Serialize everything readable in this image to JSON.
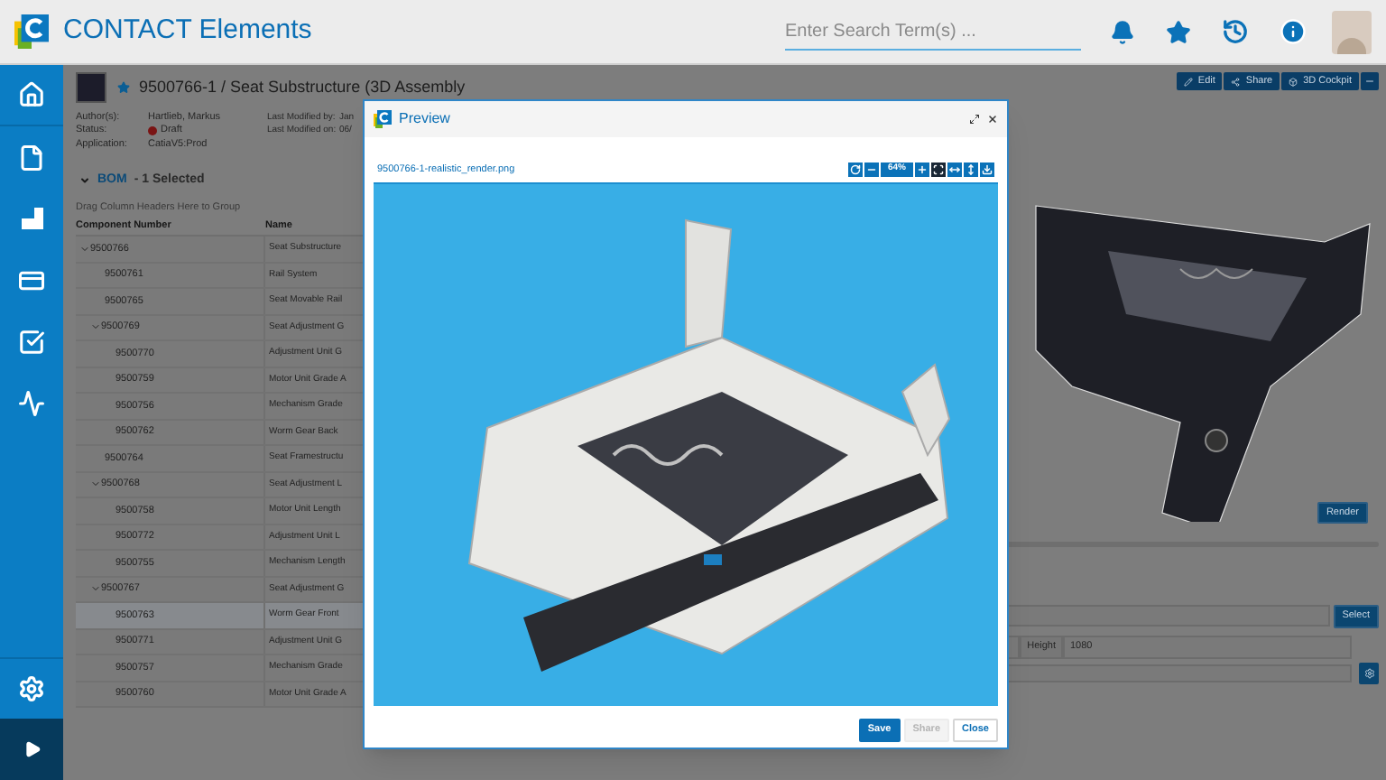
{
  "header": {
    "app_name": "CONTACT Elements",
    "search": {
      "placeholder": "Enter Search Term(s) ..."
    }
  },
  "document": {
    "title": "9500766-1 / Seat Substructure (3D Assembly",
    "properties": [
      {
        "label": "Author(s):",
        "value": "Hartlieb, Markus"
      },
      {
        "label": "Status:",
        "value": "Draft",
        "color": "#7a1414"
      },
      {
        "label": "Application:",
        "value": "CatiaV5:Prod"
      }
    ],
    "modified": [
      {
        "label": "Last Modified by:",
        "value": "Jan"
      },
      {
        "label": "Last Modified on:",
        "value": "06/"
      }
    ],
    "actions": [
      {
        "label": "Edit",
        "kind": "edit"
      },
      {
        "label": "Share",
        "kind": "share"
      },
      {
        "label": "3D Cockpit",
        "kind": "cockpit"
      }
    ]
  },
  "bom": {
    "title": "BOM",
    "selection": "- 1 Selected",
    "expanded": true,
    "group_hint": "Drag Column Headers Here to Group",
    "columns": [
      "Component Number",
      "Name"
    ],
    "rows": [
      {
        "number": "9500766",
        "name": "Seat Substructure",
        "selected": false,
        "expanded": true,
        "children": [
          {
            "number": "9500761",
            "name": "Rail System",
            "selected": false
          },
          {
            "number": "9500765",
            "name": "Seat Movable Rail",
            "selected": false
          },
          {
            "number": "9500769",
            "name": "Seat Adjustment G",
            "selected": false,
            "expanded": true,
            "children": [
              {
                "number": "9500770",
                "name": "Adjustment Unit G",
                "selected": false
              },
              {
                "number": "9500759",
                "name": "Motor Unit Grade A",
                "selected": false
              },
              {
                "number": "9500756",
                "name": "Mechanism Grade",
                "selected": false
              },
              {
                "number": "9500762",
                "name": "Worm Gear Back",
                "selected": false
              }
            ]
          },
          {
            "number": "9500764",
            "name": "Seat Framestructu",
            "selected": false
          },
          {
            "number": "9500768",
            "name": "Seat Adjustment L",
            "selected": false,
            "expanded": true,
            "children": [
              {
                "number": "9500758",
                "name": "Motor Unit Length",
                "selected": false
              },
              {
                "number": "9500772",
                "name": "Adjustment Unit L",
                "selected": false
              },
              {
                "number": "9500755",
                "name": "Mechanism Length",
                "selected": false
              }
            ]
          },
          {
            "number": "9500767",
            "name": "Seat Adjustment G",
            "selected": false,
            "expanded": true,
            "children": [
              {
                "number": "9500763",
                "name": "Worm Gear Front",
                "selected": true
              },
              {
                "number": "9500771",
                "name": "Adjustment Unit G",
                "selected": false
              },
              {
                "number": "9500757",
                "name": "Mechanism Grade",
                "selected": false
              },
              {
                "number": "9500760",
                "name": "Motor Unit Grade A",
                "selected": false
              }
            ]
          }
        ]
      }
    ]
  },
  "render_panel": {
    "render_button": "Render",
    "select_button": "Select",
    "height_label": "Height",
    "height_value": "1080"
  },
  "preview": {
    "title": "Preview",
    "filename": "9500766-1-realistic_render.png",
    "zoom": "64%",
    "fit_selected": true,
    "buttons": [
      {
        "label": "Save",
        "kind": "primary",
        "disabled": false
      },
      {
        "label": "Share",
        "disabled": true
      },
      {
        "label": "Close",
        "kind": "secondary",
        "disabled": false
      }
    ]
  }
}
